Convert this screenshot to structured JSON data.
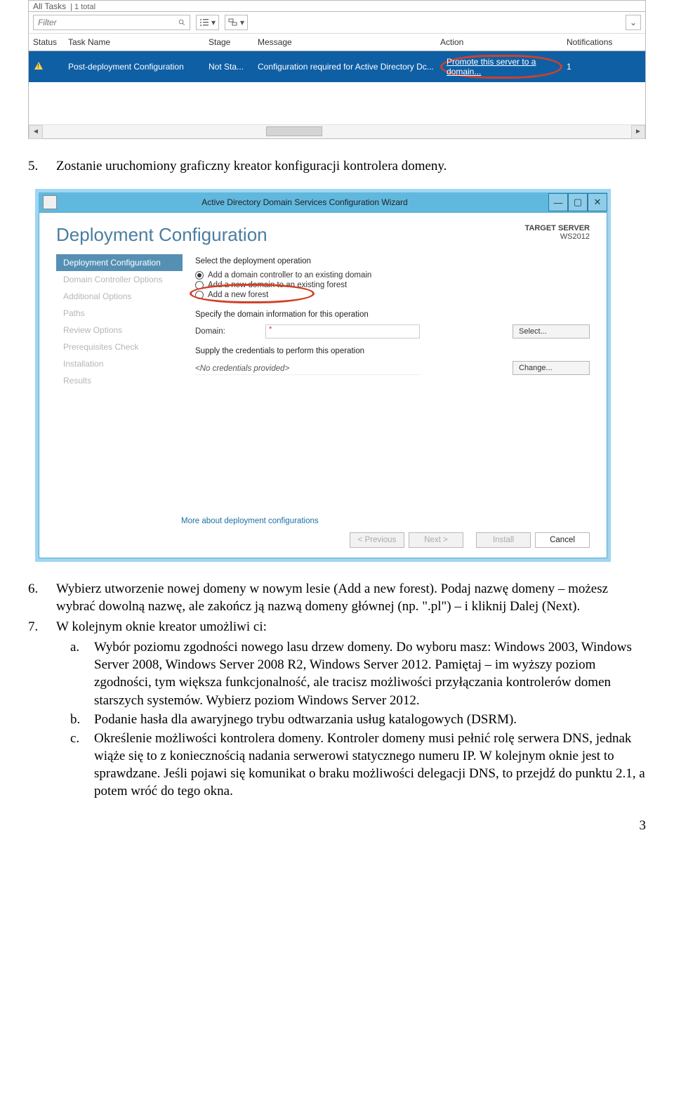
{
  "panel1": {
    "title": "All Tasks",
    "count": "| 1 total",
    "filter_placeholder": "Filter",
    "headers": {
      "status": "Status",
      "task_name": "Task Name",
      "stage": "Stage",
      "message": "Message",
      "action": "Action",
      "notifications": "Notifications"
    },
    "row": {
      "task_name": "Post-deployment Configuration",
      "stage": "Not Sta...",
      "message": "Configuration required for Active Directory Dc...",
      "action": "Promote this server to a domain...",
      "notifications": "1"
    }
  },
  "doc": {
    "li5_num": "5.",
    "li5_text": "Zostanie uruchomiony graficzny kreator konfiguracji kontrolera domeny.",
    "li6_num": "6.",
    "li6_text": "Wybierz utworzenie nowej domeny w nowym lesie (Add a new forest). Podaj nazwę domeny – możesz wybrać dowolną nazwę, ale zakończ ją nazwą domeny głównej (np. \".pl\") – i kliknij Dalej (Next).",
    "li7_num": "7.",
    "li7_text": "W kolejnym oknie kreator umożliwi ci:",
    "li7a_num": "a.",
    "li7a_text": "Wybór poziomu zgodności nowego lasu drzew domeny. Do wyboru masz: Windows 2003, Windows Server 2008, Windows Server 2008 R2, Windows Server 2012. Pamiętaj – im wyższy poziom zgodności, tym większa funkcjonalność, ale tracisz możliwości przyłączania kontrolerów domen starszych systemów. Wybierz poziom Windows Server 2012.",
    "li7b_num": "b.",
    "li7b_text": "Podanie hasła dla awaryjnego trybu odtwarzania usług katalogowych (DSRM).",
    "li7c_num": "c.",
    "li7c_text": "Określenie możliwości kontrolera domeny. Kontroler domeny musi pełnić rolę serwera DNS, jednak wiąże się to z koniecznością nadania serwerowi statycznego numeru IP. W kolejnym oknie jest to sprawdzane. Jeśli pojawi się komunikat o braku możliwości delegacji DNS, to przejdź do punktu 2.1, a potem wróć do tego okna.",
    "page_number": "3"
  },
  "wizard": {
    "title": "Active Directory Domain Services Configuration Wizard",
    "heading": "Deployment Configuration",
    "target_label": "TARGET SERVER",
    "target_value": "WS2012",
    "steps": {
      "s0": "Deployment Configuration",
      "s1": "Domain Controller Options",
      "s2": "Additional Options",
      "s3": "Paths",
      "s4": "Review Options",
      "s5": "Prerequisites Check",
      "s6": "Installation",
      "s7": "Results"
    },
    "select_label": "Select the deployment operation",
    "opt1": "Add a domain controller to an existing domain",
    "opt2": "Add a new domain to an existing forest",
    "opt3": "Add a new forest",
    "specify_label": "Specify the domain information for this operation",
    "domain_label": "Domain:",
    "domain_value": "*",
    "select_btn": "Select...",
    "creds_label": "Supply the credentials to perform this operation",
    "creds_value": "<No credentials provided>",
    "change_btn": "Change...",
    "more_link": "More about deployment configurations",
    "btn_prev": "< Previous",
    "btn_next": "Next >",
    "btn_install": "Install",
    "btn_cancel": "Cancel"
  }
}
